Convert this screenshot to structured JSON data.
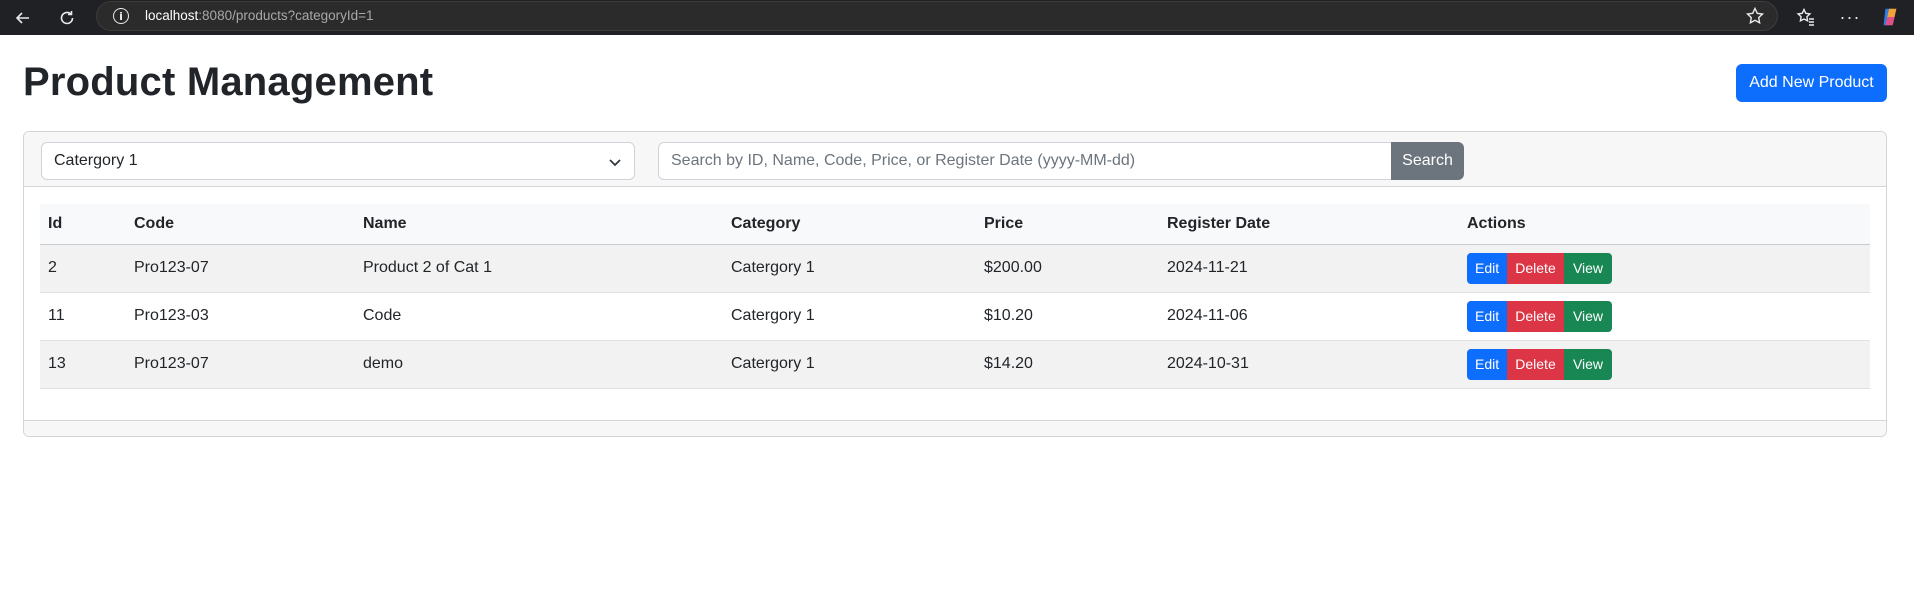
{
  "browser": {
    "url_host": "localhost",
    "url_rest": ":8080/products?categoryId=1"
  },
  "page": {
    "title": "Product Management",
    "add_button_label": "Add New Product"
  },
  "filters": {
    "category_selected": "Catergory 1",
    "search_placeholder": "Search by ID, Name, Code, Price, or Register Date (yyyy-MM-dd)",
    "search_button_label": "Search"
  },
  "table": {
    "headers": [
      "Id",
      "Code",
      "Name",
      "Category",
      "Price",
      "Register Date",
      "Actions"
    ],
    "rows": [
      {
        "id": "2",
        "code": "Pro123-07",
        "name": "Product 2 of Cat 1",
        "category": "Catergory 1",
        "price": "$200.00",
        "date": "2024-11-21"
      },
      {
        "id": "11",
        "code": "Pro123-03",
        "name": "Code",
        "category": "Catergory 1",
        "price": "$10.20",
        "date": "2024-11-06"
      },
      {
        "id": "13",
        "code": "Pro123-07",
        "name": "demo",
        "category": "Catergory 1",
        "price": "$14.20",
        "date": "2024-10-31"
      }
    ],
    "actions": {
      "edit": "Edit",
      "delete": "Delete",
      "view": "View"
    }
  },
  "colors": {
    "primary": "#0d6efd",
    "danger": "#dc3545",
    "success": "#198754",
    "secondary": "#6c757d"
  },
  "icons": {
    "back": "arrow-left-icon",
    "reload": "reload-icon",
    "info": "info-icon",
    "favorite": "star-icon",
    "favorites_list": "favorites-icon",
    "more": "more-icon",
    "copilot": "copilot-icon",
    "dropdown": "chevron-down-icon"
  }
}
